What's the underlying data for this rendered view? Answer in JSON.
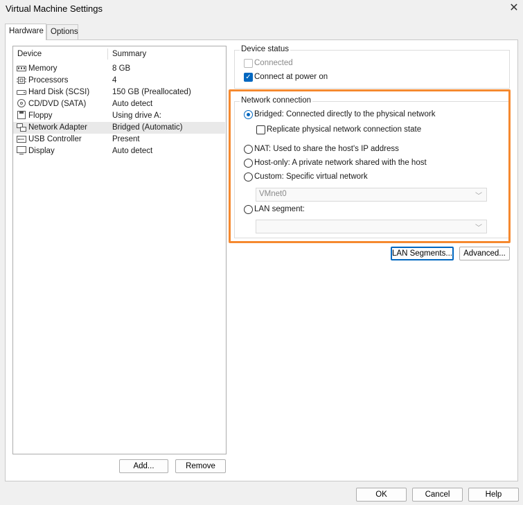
{
  "window": {
    "title": "Virtual Machine Settings",
    "close_glyph": "✕"
  },
  "tabs": [
    {
      "label": "Hardware",
      "active": true
    },
    {
      "label": "Options",
      "active": false
    }
  ],
  "device_list": {
    "columns": [
      "Device",
      "Summary"
    ],
    "rows": [
      {
        "device": "Memory",
        "summary": "8 GB",
        "icon": "memory-icon"
      },
      {
        "device": "Processors",
        "summary": "4",
        "icon": "processor-icon"
      },
      {
        "device": "Hard Disk (SCSI)",
        "summary": "150 GB (Preallocated)",
        "icon": "hard-disk-icon"
      },
      {
        "device": "CD/DVD (SATA)",
        "summary": "Auto detect",
        "icon": "cd-dvd-icon"
      },
      {
        "device": "Floppy",
        "summary": "Using drive A:",
        "icon": "floppy-icon"
      },
      {
        "device": "Network Adapter",
        "summary": "Bridged (Automatic)",
        "icon": "network-adapter-icon",
        "selected": true
      },
      {
        "device": "USB Controller",
        "summary": "Present",
        "icon": "usb-icon"
      },
      {
        "device": "Display",
        "summary": "Auto detect",
        "icon": "display-icon"
      }
    ],
    "add_label": "Add...",
    "remove_label": "Remove"
  },
  "device_status": {
    "title": "Device status",
    "connected_label": "Connected",
    "connected_checked": false,
    "connect_power_label": "Connect at power on",
    "connect_power_checked": true
  },
  "network_connection": {
    "title": "Network connection",
    "bridged_label": "Bridged: Connected directly to the physical network",
    "replicate_label": "Replicate physical network connection state",
    "nat_label": "NAT: Used to share the host's IP address",
    "hostonly_label": "Host-only: A private network shared with the host",
    "custom_label": "Custom: Specific virtual network",
    "custom_value": "VMnet0",
    "lan_label": "LAN segment:",
    "lan_value": "",
    "selected": "bridged"
  },
  "buttons": {
    "lan_segments": "LAN Segments...",
    "advanced": "Advanced...",
    "ok": "OK",
    "cancel": "Cancel",
    "help": "Help"
  },
  "colors": {
    "accent": "#0067c0",
    "highlight": "#f5892f"
  }
}
